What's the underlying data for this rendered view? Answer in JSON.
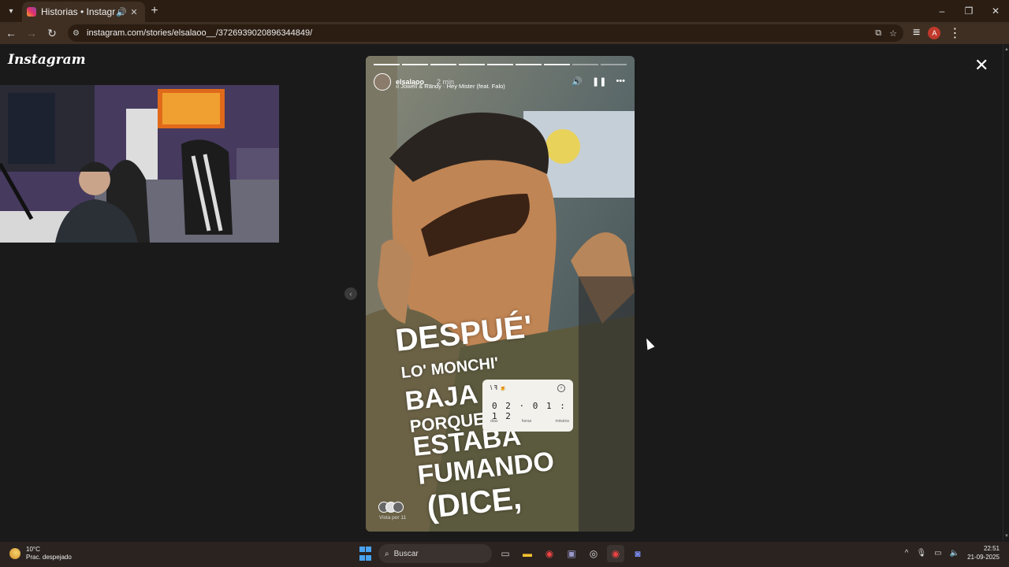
{
  "browser": {
    "tab_title": "Historias • Instagram",
    "url": "instagram.com/stories/elsalaoo__/3726939020896344849/"
  },
  "instagram": {
    "logo": "Instagram"
  },
  "story": {
    "username": "elsalaoo__",
    "time": "2 min",
    "music": "Jowell & Randy · Hey Mister (feat. Falo)",
    "overlay_lines": [
      "DESPUÉ'",
      "LO' MONCHI'",
      "BAJA",
      "PORQUE",
      "ESTABA",
      "FUMANDO",
      "(DICE,"
    ],
    "countdown": {
      "header": "\\ ꟻ 🍺",
      "digits": "0 2 · 0 1 : 1 2",
      "units": [
        "días",
        "horas",
        "minutos"
      ]
    },
    "viewers_label": "Vista por 11"
  },
  "taskbar": {
    "temp": "10°C",
    "condition": "Prac. despejado",
    "search_placeholder": "Buscar",
    "time": "22:51",
    "date": "21-09-2025"
  }
}
